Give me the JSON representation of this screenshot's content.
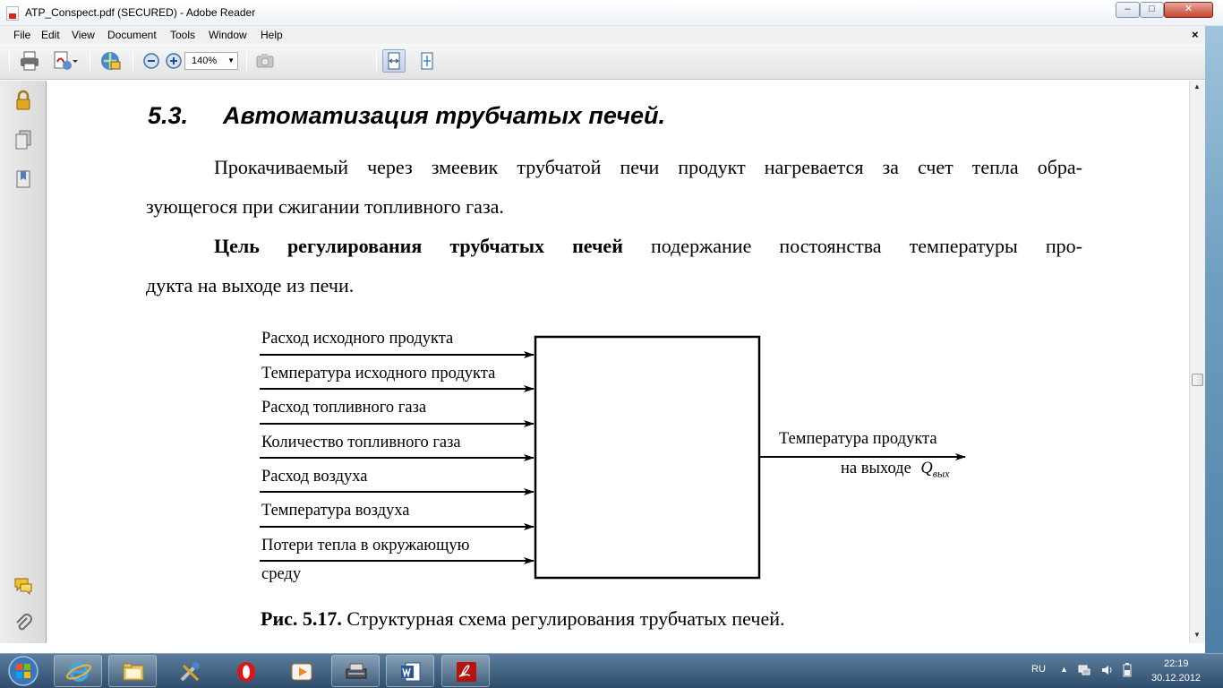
{
  "window": {
    "title": "ATP_Conspect.pdf (SECURED) - Adobe Reader",
    "minimize_glyph": "–",
    "maximize_glyph": "□",
    "close_glyph": "✕"
  },
  "menu": {
    "items": [
      "File",
      "Edit",
      "View",
      "Document",
      "Tools",
      "Window",
      "Help"
    ],
    "doc_close_glyph": "×"
  },
  "toolbar": {
    "zoom_value": "140%",
    "icons": [
      "print-icon",
      "create-pdf-icon",
      "collaborate-icon",
      "zoom-out-icon",
      "zoom-in-icon",
      "snapshot-icon",
      "fit-width-icon",
      "fit-page-icon"
    ]
  },
  "left_nav": {
    "icons": [
      "lock-icon",
      "pages-icon",
      "bookmarks-icon",
      "comments-icon",
      "attachments-icon"
    ]
  },
  "document": {
    "heading_number": "5.3.",
    "heading_text": "Автоматизация трубчатых печей.",
    "para1_line1": "Прокачиваемый через змеевик трубчатой печи продукт нагревается за счет тепла обра-",
    "para1_line2": "зующегося при сжигании топливного газа.",
    "para2_bold": "Цель регулирования трубчатых печей",
    "para2_rest": " подержание постоянства температуры про-",
    "para2_line2": "дукта на выходе из печи.",
    "diagram": {
      "inputs": [
        "Расход исходного продукта",
        "Температура исходного продукта",
        "Расход топливного газа",
        "Количество топливного газа",
        "Расход воздуха",
        "Температура воздуха",
        "Потери тепла в окружающую"
      ],
      "input_last_line2": "среду",
      "output_line1": "Температура продукта",
      "output_line2": "на выходе",
      "output_symbol": "Q",
      "output_subscript": "вых"
    },
    "caption_bold": "Рис. 5.17.",
    "caption_text": " Структурная схема регулирования трубчатых печей."
  },
  "taskbar": {
    "apps": [
      "internet-explorer-icon",
      "file-explorer-icon",
      "tools-icon",
      "opera-icon",
      "media-player-icon",
      "scanner-icon",
      "word-icon",
      "adobe-reader-icon"
    ],
    "language": "RU",
    "time": "22:19",
    "date": "30.12.2012"
  }
}
